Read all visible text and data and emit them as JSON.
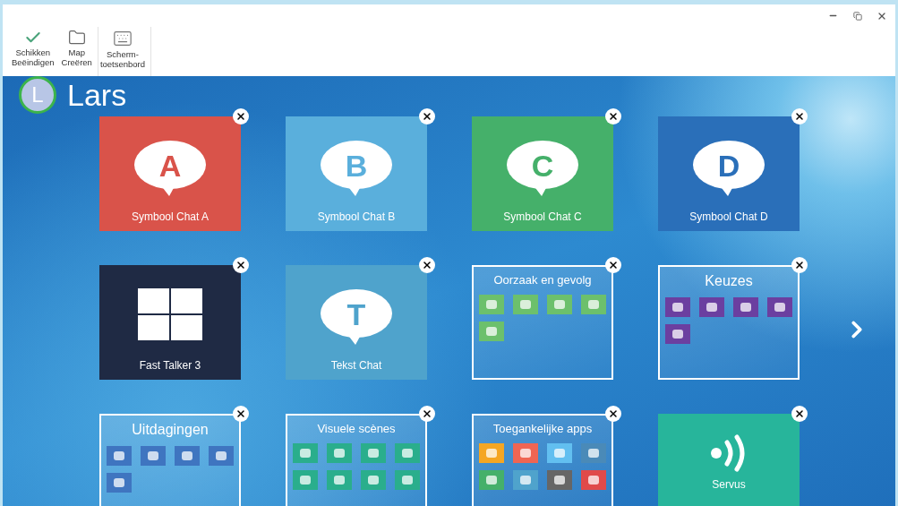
{
  "toolbar": {
    "buttons": [
      {
        "kind": "check",
        "label": "Schikken\nBeëindigen"
      },
      {
        "kind": "folder",
        "label": "Map\nCreëren"
      },
      {
        "kind": "keyboard",
        "label": "Scherm-\ntoetsenbord"
      }
    ]
  },
  "user": {
    "initial": "L",
    "name": "Lars"
  },
  "tiles": [
    {
      "kind": "chat",
      "letter": "A",
      "label": "Symbool Chat A",
      "color": "#d9534a"
    },
    {
      "kind": "chat",
      "letter": "B",
      "label": "Symbool Chat B",
      "color": "#5aafdc"
    },
    {
      "kind": "chat",
      "letter": "C",
      "label": "Symbool Chat C",
      "color": "#45b06a"
    },
    {
      "kind": "chat",
      "letter": "D",
      "label": "Symbool Chat D",
      "color": "#2a6fb9"
    },
    {
      "kind": "windows",
      "label": "Fast Talker 3",
      "color": "#1f2a44"
    },
    {
      "kind": "chat",
      "letter": "T",
      "label": "Tekst Chat",
      "color": "#4fa3cc"
    },
    {
      "kind": "folder",
      "label": "Oorzaak en gevolg",
      "items": [
        {
          "color": "#6cc06c"
        },
        {
          "color": "#6cc06c"
        },
        {
          "color": "#6cc06c"
        },
        {
          "color": "#6cc06c"
        },
        {
          "color": "#6cc06c"
        }
      ]
    },
    {
      "kind": "folder",
      "label": "Keuzes",
      "items": [
        {
          "color": "#6b3fa0"
        },
        {
          "color": "#6b3fa0"
        },
        {
          "color": "#6b3fa0"
        },
        {
          "color": "#6b3fa0"
        },
        {
          "color": "#6b3fa0"
        }
      ]
    },
    {
      "kind": "folder",
      "label": "Uitdagingen",
      "items": [
        {
          "color": "#3f75c0"
        },
        {
          "color": "#3f75c0"
        },
        {
          "color": "#3f75c0"
        },
        {
          "color": "#3f75c0"
        },
        {
          "color": "#3f75c0"
        }
      ]
    },
    {
      "kind": "folder",
      "label": "Visuele scènes",
      "items": [
        {
          "color": "#2aae8c"
        },
        {
          "color": "#2aae8c"
        },
        {
          "color": "#2aae8c"
        },
        {
          "color": "#2aae8c"
        },
        {
          "color": "#2aae8c"
        },
        {
          "color": "#2aae8c"
        },
        {
          "color": "#2aae8c"
        },
        {
          "color": "#2aae8c"
        }
      ]
    },
    {
      "kind": "folder",
      "label": "Toegankelijke apps",
      "items": [
        {
          "color": "#f5a623"
        },
        {
          "color": "#f06553"
        },
        {
          "color": "#62bff0"
        },
        {
          "color": "#4a8ab8"
        },
        {
          "color": "#45b06a"
        },
        {
          "color": "#4fa3cc"
        },
        {
          "color": "#666666"
        },
        {
          "color": "#e04a4a"
        }
      ]
    },
    {
      "kind": "app",
      "label": "Servus",
      "color": "#27b59b"
    }
  ]
}
